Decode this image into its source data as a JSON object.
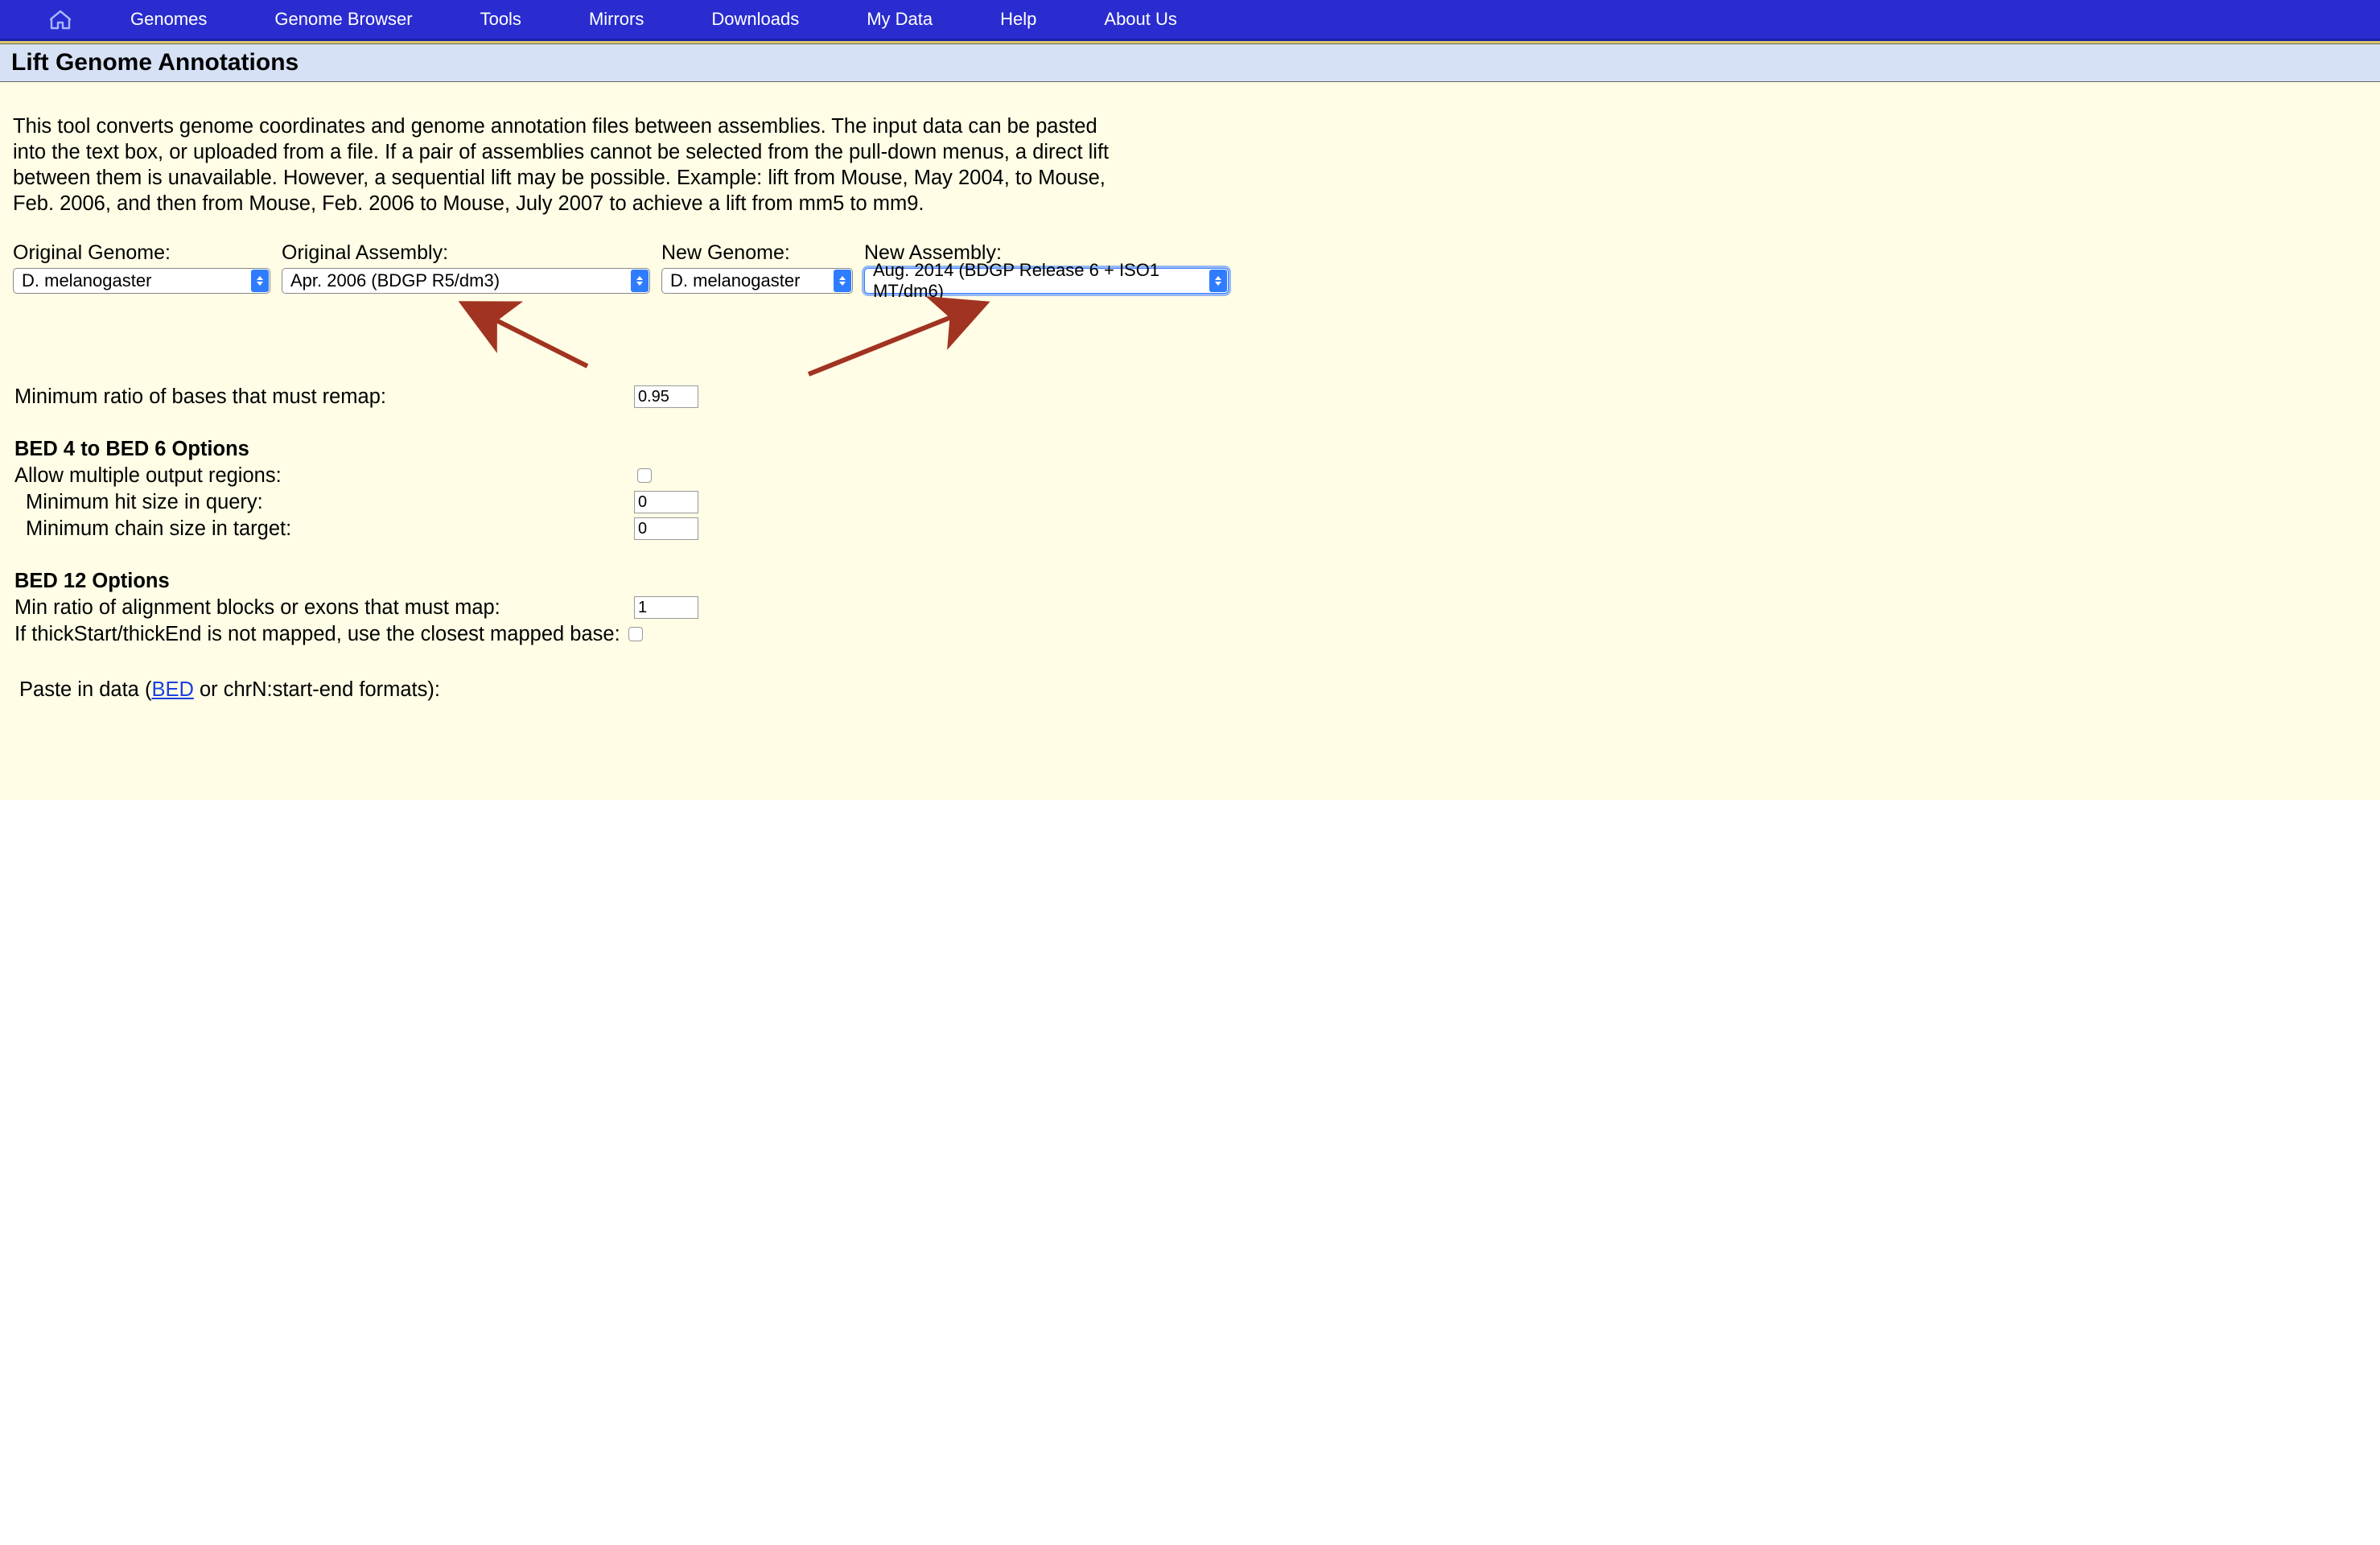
{
  "nav": {
    "items": [
      "Genomes",
      "Genome Browser",
      "Tools",
      "Mirrors",
      "Downloads",
      "My Data",
      "Help",
      "About Us"
    ]
  },
  "title": "Lift Genome Annotations",
  "intro": "This tool converts genome coordinates and genome annotation files between assemblies.  The input data can be pasted into the text box, or uploaded from a file.  If a pair of assemblies cannot be selected from the pull-down menus, a direct lift between them is unavailable.  However, a sequential lift may be possible.  Example: lift from Mouse, May 2004, to Mouse, Feb. 2006, and then from Mouse, Feb. 2006 to Mouse, July 2007 to achieve a lift from mm5 to mm9.",
  "selectors": {
    "original_genome": {
      "label": "Original Genome:",
      "value": "D. melanogaster"
    },
    "original_assembly": {
      "label": "Original Assembly:",
      "value": "Apr. 2006 (BDGP R5/dm3)"
    },
    "new_genome": {
      "label": "New Genome:",
      "value": "D. melanogaster"
    },
    "new_assembly": {
      "label": "New Assembly:",
      "value": "Aug. 2014 (BDGP Release 6 + ISO1 MT/dm6)"
    }
  },
  "form": {
    "min_ratio_label": "Minimum ratio of bases that must remap:",
    "min_ratio_value": "0.95",
    "bed46_header": "BED 4 to BED 6 Options",
    "allow_multiple_label": "Allow multiple output regions:",
    "min_hit_label": "Minimum hit size in query:",
    "min_hit_value": "0",
    "min_chain_label": "Minimum chain size in target:",
    "min_chain_value": "0",
    "bed12_header": "BED 12 Options",
    "min_blocks_label": "Min ratio of alignment blocks or exons that must map:",
    "min_blocks_value": "1",
    "thick_label": "If thickStart/thickEnd is not mapped, use the closest mapped base:",
    "paste_prefix": "Paste in data (",
    "paste_link": "BED",
    "paste_suffix": " or chrN:start-end formats):"
  }
}
